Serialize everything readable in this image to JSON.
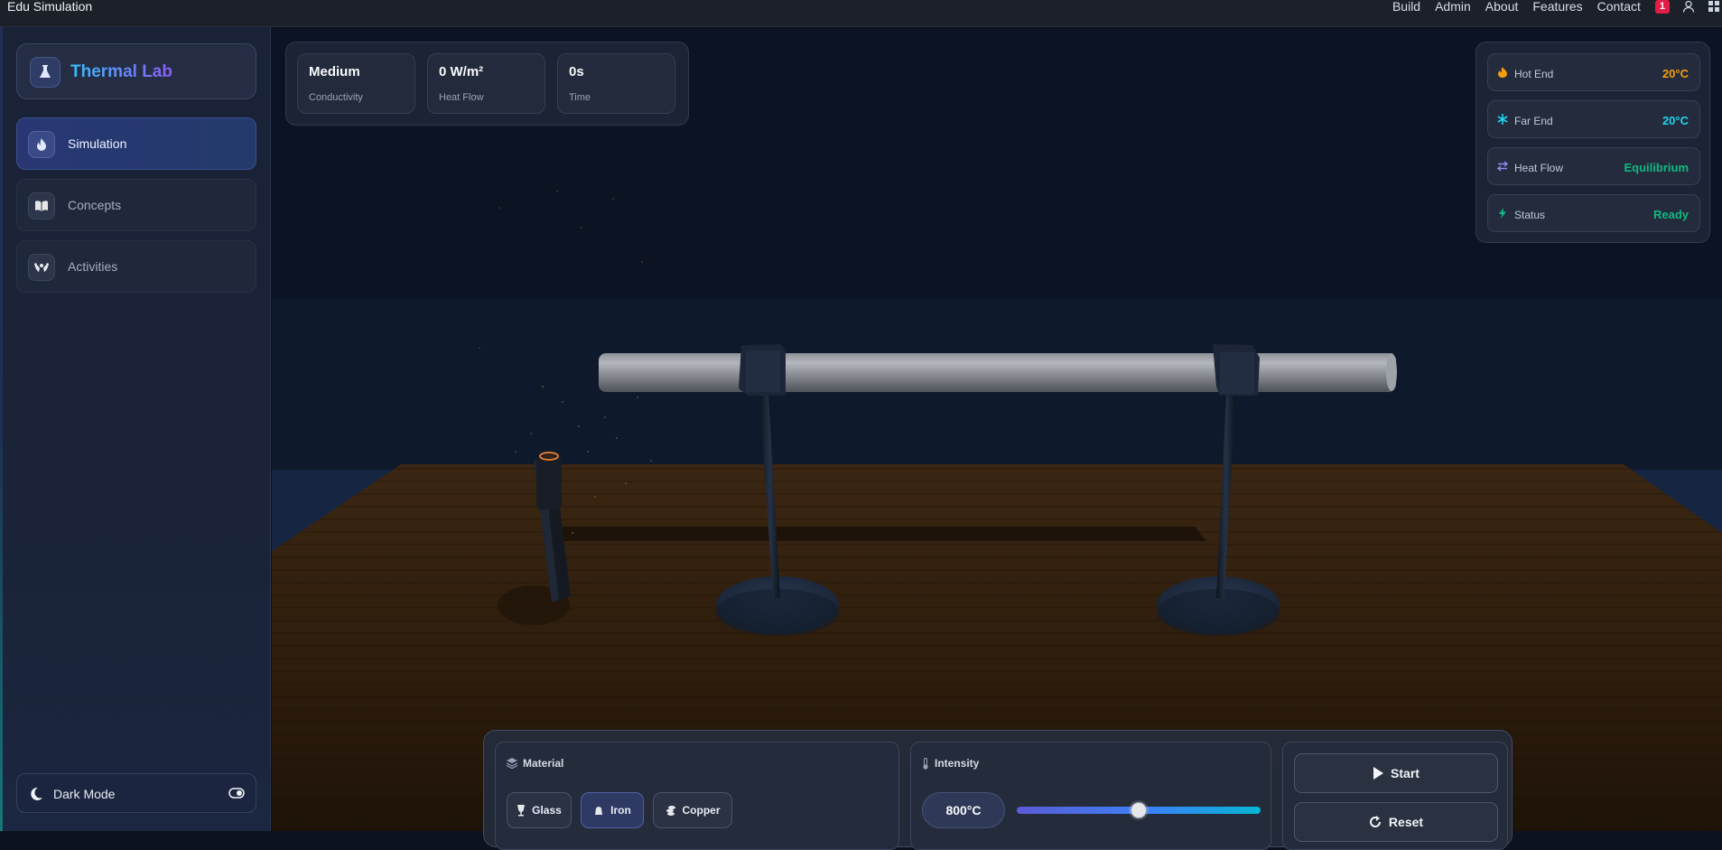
{
  "topbar": {
    "brand": "Edu Simulation",
    "nav": [
      "Build",
      "Admin",
      "About",
      "Features",
      "Contact"
    ],
    "notification_count": "1"
  },
  "sidebar": {
    "logo_text": "Thermal Lab",
    "items": [
      {
        "label": "Simulation",
        "icon": "flame-icon",
        "active": true
      },
      {
        "label": "Concepts",
        "icon": "book-icon",
        "active": false
      },
      {
        "label": "Activities",
        "icon": "hands-icon",
        "active": false
      }
    ],
    "dark_mode_label": "Dark Mode"
  },
  "stats": [
    {
      "value": "Medium",
      "label": "Conductivity"
    },
    {
      "value": "0 W/m²",
      "label": "Heat Flow"
    },
    {
      "value": "0s",
      "label": "Time"
    }
  ],
  "status": {
    "rows": [
      {
        "label": "Hot End",
        "value": "20°C",
        "color": "#f59e0b",
        "icon": "flame-icon"
      },
      {
        "label": "Far End",
        "value": "20°C",
        "color": "#22d3ee",
        "icon": "snowflake-icon"
      },
      {
        "label": "Heat Flow",
        "value": "Equilibrium",
        "color": "#10b981",
        "icon": "arrows-icon"
      },
      {
        "label": "Status",
        "value": "Ready",
        "color": "#10b981",
        "icon": "bolt-icon"
      }
    ]
  },
  "controls": {
    "material_title": "Material",
    "materials": [
      "Glass",
      "Iron",
      "Copper"
    ],
    "selected_material": "Iron",
    "intensity_title": "Intensity",
    "intensity_value": "800°C",
    "slider_fraction": 0.5,
    "start_label": "Start",
    "reset_label": "Reset"
  },
  "colors": {
    "accent": "#6366f1",
    "hot": "#f59e0b",
    "cold": "#22d3ee",
    "ok": "#10b981"
  }
}
